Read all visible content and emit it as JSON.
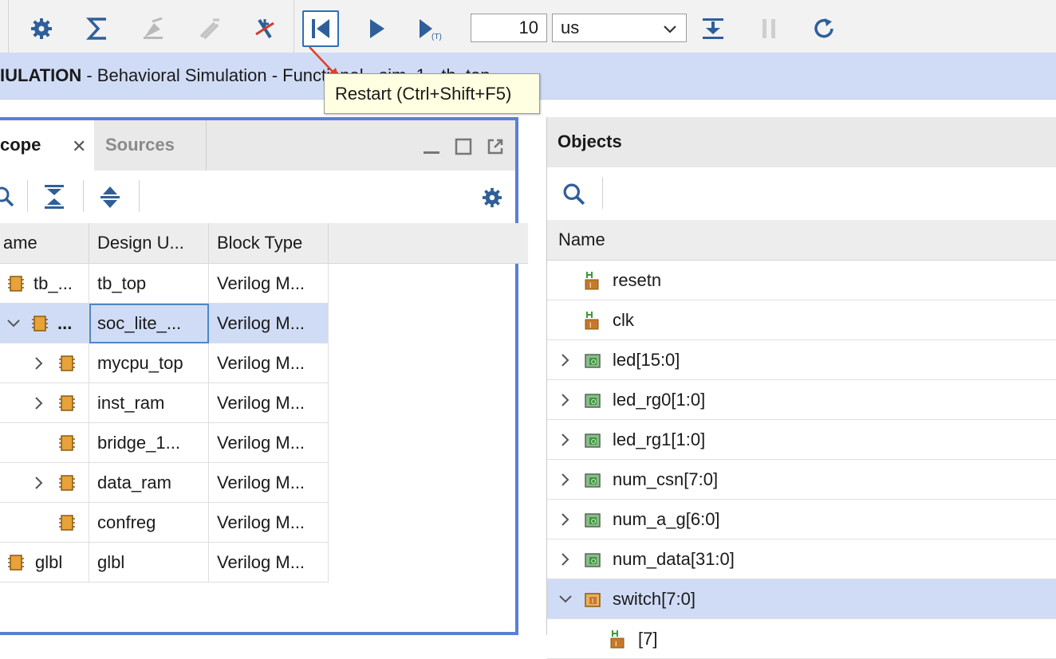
{
  "toolbar": {
    "run_time_value": "10",
    "run_time_unit": "us",
    "buttons": [
      "settings-icon",
      "sigma-icon",
      "probe-icon",
      "probe-disabled-icon",
      "breakpoint-icon",
      "restart-icon",
      "run-all-icon",
      "run-for-time-icon",
      "step-icon",
      "break-icon",
      "relaunch-icon"
    ]
  },
  "banner": {
    "prefix": "IULATION",
    "text": " - Behavioral Simulation - Functional - sim_1 - tb_top"
  },
  "tooltip": {
    "text": "Restart (Ctrl+Shift+F5)"
  },
  "scope_panel": {
    "tab_scope": "cope",
    "tab_sources": "Sources",
    "columns": [
      "ame",
      "Design U...",
      "Block Type"
    ],
    "rows": [
      {
        "name": "tb_...",
        "design": "tb_top",
        "block": "Verilog M..."
      },
      {
        "name": "...",
        "design": "soc_lite_...",
        "block": "Verilog M..."
      },
      {
        "name": "",
        "design": "mycpu_top",
        "block": "Verilog M..."
      },
      {
        "name": "",
        "design": "inst_ram",
        "block": "Verilog M..."
      },
      {
        "name": "",
        "design": "bridge_1...",
        "block": "Verilog M..."
      },
      {
        "name": "",
        "design": "data_ram",
        "block": "Verilog M..."
      },
      {
        "name": "",
        "design": "confreg",
        "block": "Verilog M..."
      },
      {
        "name": "glbl",
        "design": "glbl",
        "block": "Verilog M..."
      }
    ]
  },
  "objects_panel": {
    "title": "Objects",
    "column": "Name",
    "rows": [
      {
        "name": "resetn"
      },
      {
        "name": "clk"
      },
      {
        "name": "led[15:0]"
      },
      {
        "name": "led_rg0[1:0]"
      },
      {
        "name": "led_rg1[1:0]"
      },
      {
        "name": "num_csn[7:0]"
      },
      {
        "name": "num_a_g[6:0]"
      },
      {
        "name": "num_data[31:0]"
      },
      {
        "name": "switch[7:0]"
      },
      {
        "name": "[7]"
      }
    ]
  },
  "colors": {
    "accent_border": "#5b7fd6",
    "selection": "#d0dcf6",
    "icon_blue": "#2f5f99",
    "chip_orange": "#e8a23a",
    "tooltip_bg": "#ffffe1"
  }
}
